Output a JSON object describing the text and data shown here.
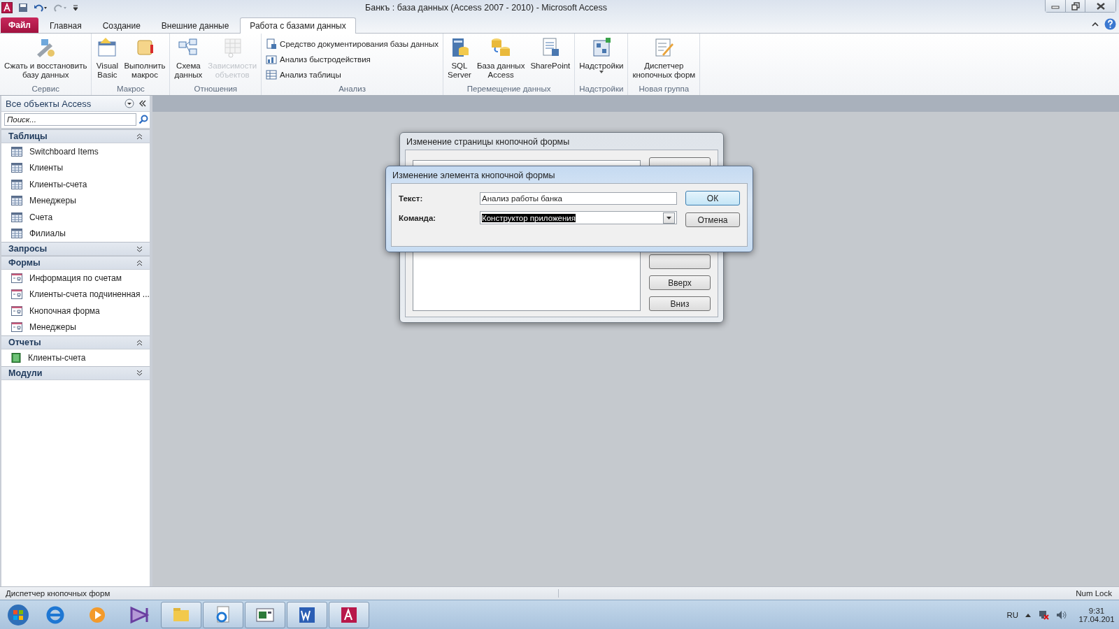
{
  "window": {
    "title": "Банкъ : база данных (Access 2007 - 2010)  -  Microsoft Access"
  },
  "ribbon": {
    "file_tab": "Файл",
    "tabs": [
      {
        "label": "Главная",
        "selected": false
      },
      {
        "label": "Создание",
        "selected": false
      },
      {
        "label": "Внешние данные",
        "selected": false
      },
      {
        "label": "Работа с базами данных",
        "selected": true
      }
    ],
    "groups": [
      {
        "label": "Сервис",
        "items": [
          {
            "kind": "large",
            "lines": [
              "Сжать и восстановить",
              "базу данных"
            ],
            "disabled": false
          }
        ]
      },
      {
        "label": "Макрос",
        "items": [
          {
            "kind": "large",
            "lines": [
              "Visual",
              "Basic"
            ],
            "disabled": false
          },
          {
            "kind": "large",
            "lines": [
              "Выполнить",
              "макрос"
            ],
            "disabled": false
          }
        ]
      },
      {
        "label": "Отношения",
        "items": [
          {
            "kind": "large",
            "lines": [
              "Схема",
              "данных"
            ],
            "disabled": false
          },
          {
            "kind": "large",
            "lines": [
              "Зависимости",
              "объектов"
            ],
            "disabled": true
          }
        ]
      },
      {
        "label": "Анализ",
        "items": [
          {
            "kind": "small",
            "lines": [
              "Средство документирования базы данных"
            ],
            "disabled": false
          },
          {
            "kind": "small",
            "lines": [
              "Анализ быстродействия"
            ],
            "disabled": false
          },
          {
            "kind": "small",
            "lines": [
              "Анализ таблицы"
            ],
            "disabled": false
          }
        ]
      },
      {
        "label": "Перемещение данных",
        "items": [
          {
            "kind": "large",
            "lines": [
              "SQL",
              "Server"
            ],
            "disabled": false
          },
          {
            "kind": "large",
            "lines": [
              "База данных",
              "Access"
            ],
            "disabled": false
          },
          {
            "kind": "large",
            "lines": [
              "SharePoint"
            ],
            "disabled": false
          }
        ]
      },
      {
        "label": "Надстройки",
        "items": [
          {
            "kind": "menu",
            "lines": [
              "Надстройки"
            ],
            "disabled": false
          }
        ]
      },
      {
        "label": "Новая группа",
        "items": [
          {
            "kind": "large",
            "lines": [
              "Диспетчер",
              "кнопочных форм"
            ],
            "disabled": false
          }
        ]
      }
    ]
  },
  "nav": {
    "title": "Все объекты Access",
    "search": {
      "placeholder": "Поиск..."
    },
    "groups": [
      {
        "label": "Таблицы",
        "kind": "table",
        "expanded": true,
        "items": [
          {
            "label": "Switchboard Items"
          },
          {
            "label": "Клиенты"
          },
          {
            "label": "Клиенты-счета"
          },
          {
            "label": "Менеджеры"
          },
          {
            "label": "Счета"
          },
          {
            "label": "Филиалы"
          }
        ]
      },
      {
        "label": "Запросы",
        "expanded": false
      },
      {
        "label": "Формы",
        "kind": "form",
        "expanded": true,
        "items": [
          {
            "label": "Информация по счетам"
          },
          {
            "label": "Клиенты-счета подчиненная ..."
          },
          {
            "label": "Кнопочная форма"
          },
          {
            "label": "Менеджеры"
          }
        ]
      },
      {
        "label": "Отчеты",
        "kind": "report",
        "expanded": true,
        "items": [
          {
            "label": "Клиенты-счета"
          }
        ]
      },
      {
        "label": "Модули",
        "expanded": false
      }
    ]
  },
  "back_dialog": {
    "title": "Изменение страницы кнопочной формы",
    "buttons": [
      {
        "label": "Вверх"
      },
      {
        "label": "Вниз"
      }
    ]
  },
  "dialog": {
    "title": "Изменение элемента кнопочной формы",
    "fields": [
      {
        "kind": "text",
        "label": "Текст:",
        "value": "Анализ работы банка",
        "highlighted": false
      },
      {
        "kind": "combo",
        "label": "Команда:",
        "value": "Конструктор приложения",
        "highlighted": true
      }
    ],
    "buttons": [
      {
        "label": "ОК",
        "default": true
      },
      {
        "label": "Отмена",
        "default": false
      }
    ]
  },
  "status_bar": {
    "message": "Диспетчер кнопочных форм",
    "indicator": "Num Lock"
  },
  "taskbar": {
    "apps": [
      {
        "open": false
      },
      {
        "open": false
      },
      {
        "open": false
      },
      {
        "open": true
      },
      {
        "open": true
      },
      {
        "open": true
      },
      {
        "open": true
      },
      {
        "open": true
      }
    ],
    "language": "RU",
    "time": "9:31",
    "date": "17.04.201"
  }
}
